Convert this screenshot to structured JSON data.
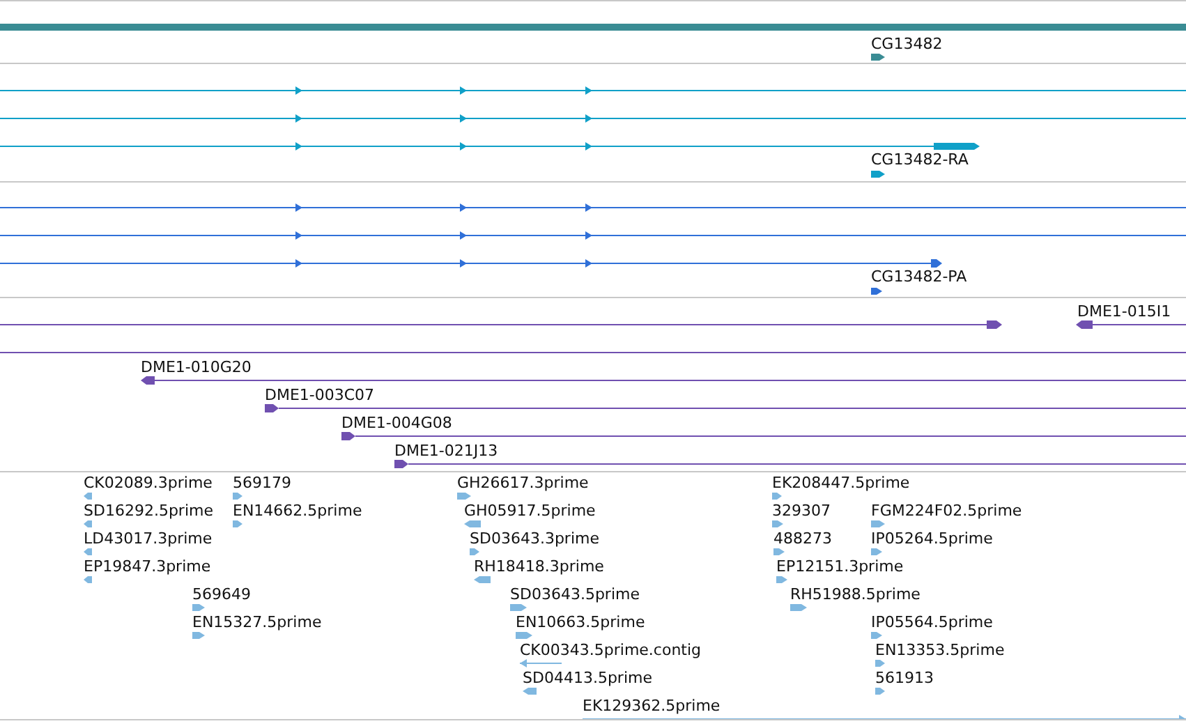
{
  "tracks": [
    {
      "kind": "gene",
      "features": [
        {
          "label": "CG13482",
          "reverse": false
        }
      ]
    },
    {
      "kind": "transcript",
      "features": [
        {
          "reverse": false
        },
        {
          "reverse": false
        },
        {
          "reverse": false
        },
        {
          "label": "CG13482-RA",
          "reverse": false
        }
      ]
    },
    {
      "kind": "protein",
      "features": [
        {
          "reverse": false
        },
        {
          "reverse": false
        },
        {
          "reverse": false
        },
        {
          "label": "CG13482-PA",
          "reverse": false
        }
      ]
    },
    {
      "kind": "clone",
      "features": [
        {
          "reverse": false
        },
        {
          "label": "DME1-015I1",
          "reverse": true
        },
        {
          "label": "DME1-010G20",
          "reverse": true
        },
        {
          "label": "DME1-003C07",
          "reverse": false
        },
        {
          "label": "DME1-004G08",
          "reverse": false
        },
        {
          "label": "DME1-021J13",
          "reverse": false
        }
      ]
    },
    {
      "kind": "est",
      "features": [
        {
          "label": "CK02089.3prime",
          "reverse": true
        },
        {
          "label": "569179",
          "reverse": false
        },
        {
          "label": "SD16292.5prime",
          "reverse": true
        },
        {
          "label": "EN14662.5prime",
          "reverse": false
        },
        {
          "label": "LD43017.3prime",
          "reverse": true
        },
        {
          "label": "EP19847.3prime",
          "reverse": true
        },
        {
          "label": "569649",
          "reverse": false
        },
        {
          "label": "EN15327.5prime",
          "reverse": false
        },
        {
          "label": "GH26617.3prime",
          "reverse": false
        },
        {
          "label": "GH05917.5prime",
          "reverse": true
        },
        {
          "label": "SD03643.3prime",
          "reverse": false
        },
        {
          "label": "RH18418.3prime",
          "reverse": true
        },
        {
          "label": "SD03643.5prime",
          "reverse": false
        },
        {
          "label": "EN10663.5prime",
          "reverse": false
        },
        {
          "label": "CK00343.5prime.contig",
          "reverse": true
        },
        {
          "label": "SD04413.5prime",
          "reverse": true
        },
        {
          "label": "EK129362.5prime",
          "reverse": false
        },
        {
          "label": "EK208447.5prime",
          "reverse": false
        },
        {
          "label": "329307",
          "reverse": false
        },
        {
          "label": "FGM224F02.5prime",
          "reverse": false
        },
        {
          "label": "488273",
          "reverse": false
        },
        {
          "label": "IP05264.5prime",
          "reverse": false
        },
        {
          "label": "EP12151.3prime",
          "reverse": false
        },
        {
          "label": "RH51988.5prime",
          "reverse": false
        },
        {
          "label": "IP05564.5prime",
          "reverse": false
        },
        {
          "label": "EN13353.5prime",
          "reverse": false
        },
        {
          "label": "561913",
          "reverse": false
        }
      ]
    }
  ]
}
